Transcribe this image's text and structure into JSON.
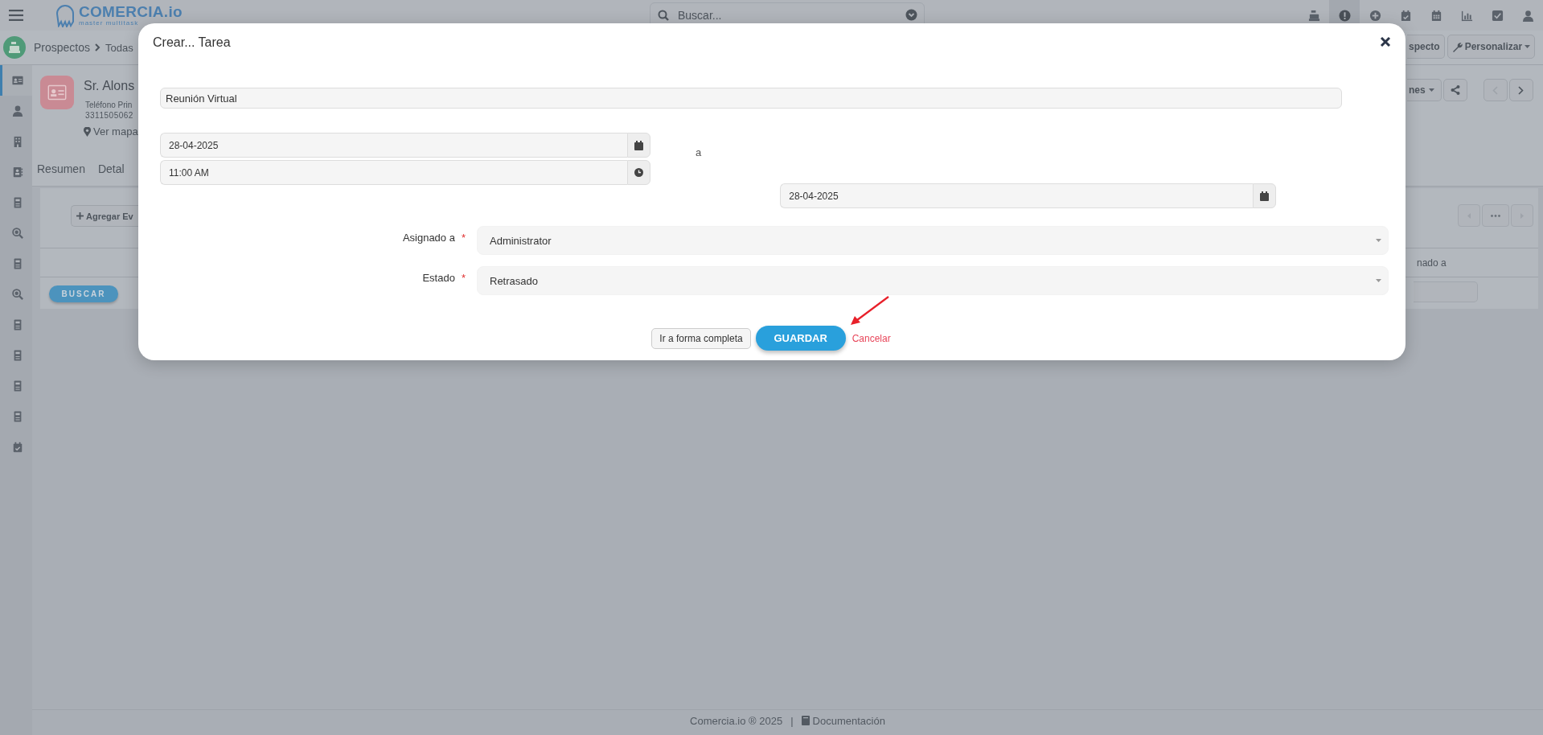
{
  "top_bar": {
    "logo": {
      "name": "COMERCIA.io",
      "tagline": "master multitask"
    },
    "search": {
      "placeholder": "Buscar..."
    },
    "icons": [
      {
        "kind": "register",
        "selected": false
      },
      {
        "kind": "alert",
        "selected": true
      },
      {
        "kind": "plus",
        "selected": false
      },
      {
        "kind": "calendar-check",
        "selected": false
      },
      {
        "kind": "calendar",
        "selected": false
      },
      {
        "kind": "chart",
        "selected": false
      },
      {
        "kind": "check",
        "selected": false
      },
      {
        "kind": "user",
        "selected": false
      }
    ]
  },
  "breadcrumb": [
    "Prospectos",
    "Todas"
  ],
  "header_buttons": [
    {
      "label": "specto",
      "caret": false
    },
    {
      "label": "Personalizar",
      "caret": true
    }
  ],
  "sidebar": {
    "items": [
      {
        "kind": "id-card",
        "selected": true
      },
      {
        "kind": "person",
        "selected": false
      },
      {
        "kind": "building",
        "selected": false
      },
      {
        "kind": "contacts",
        "selected": false
      },
      {
        "kind": "document",
        "selected": false
      },
      {
        "kind": "money-search",
        "selected": false
      },
      {
        "kind": "document",
        "selected": false
      },
      {
        "kind": "money-search",
        "selected": false
      },
      {
        "kind": "document",
        "selected": false
      },
      {
        "kind": "document",
        "selected": false
      },
      {
        "kind": "document",
        "selected": false
      },
      {
        "kind": "document",
        "selected": false
      },
      {
        "kind": "calendar-check",
        "selected": false
      }
    ]
  },
  "record": {
    "name": "Sr. Alons",
    "phone_label": "Teléfono Prin",
    "phone": "3311505062",
    "map_link": "Ver mapa",
    "tabs": [
      "Resumen",
      "Detal"
    ],
    "actions_dropdown": "nes"
  },
  "panel": {
    "add_button": "Agregar Ev",
    "search_button": "BUSCAR",
    "column_header": "nado a"
  },
  "modal": {
    "title": "Crear... Tarea",
    "subject": "Reunión Virtual",
    "start_date": "28-04-2025",
    "start_time": "11:00 AM",
    "range_word": "a",
    "end_date": "28-04-2025",
    "fields": [
      {
        "label": "Asignado a",
        "required_mark": "*",
        "value": "Administrator"
      },
      {
        "label": "Estado",
        "required_mark": "*",
        "value": "Retrasado"
      }
    ],
    "buttons": {
      "full_form": "Ir a forma completa",
      "save": "GUARDAR",
      "cancel": "Cancelar"
    }
  },
  "footer": {
    "brand": "Comercia.io ® 2025",
    "separator": "|",
    "doc_link": "Documentación"
  }
}
